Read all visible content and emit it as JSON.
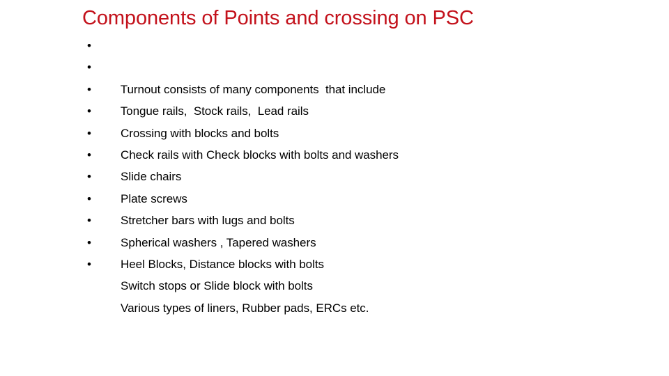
{
  "slide": {
    "title": "Components of Points and crossing on PSC",
    "title_color": "#c3111b",
    "background_color": "#ffffff",
    "body_color": "#000000",
    "bullet_glyph": "•",
    "bullets": [
      {
        "text": "Turnout consists of many components  that include"
      },
      {
        "text": "Tongue rails,  Stock rails,  Lead rails"
      },
      {
        "text": "Crossing with blocks and bolts"
      },
      {
        "text": "Check rails with Check blocks with bolts and washers"
      },
      {
        "text": "Slide chairs"
      },
      {
        "text": "Plate screws"
      },
      {
        "text": "Stretcher bars with lugs and bolts"
      },
      {
        "text": "Spherical washers , Tapered washers"
      },
      {
        "text": "Heel Blocks, Distance blocks with bolts"
      },
      {
        "text": "Switch stops or Slide block with bolts"
      },
      {
        "text": "Various types of liners, Rubber pads, ERCs etc."
      }
    ]
  }
}
